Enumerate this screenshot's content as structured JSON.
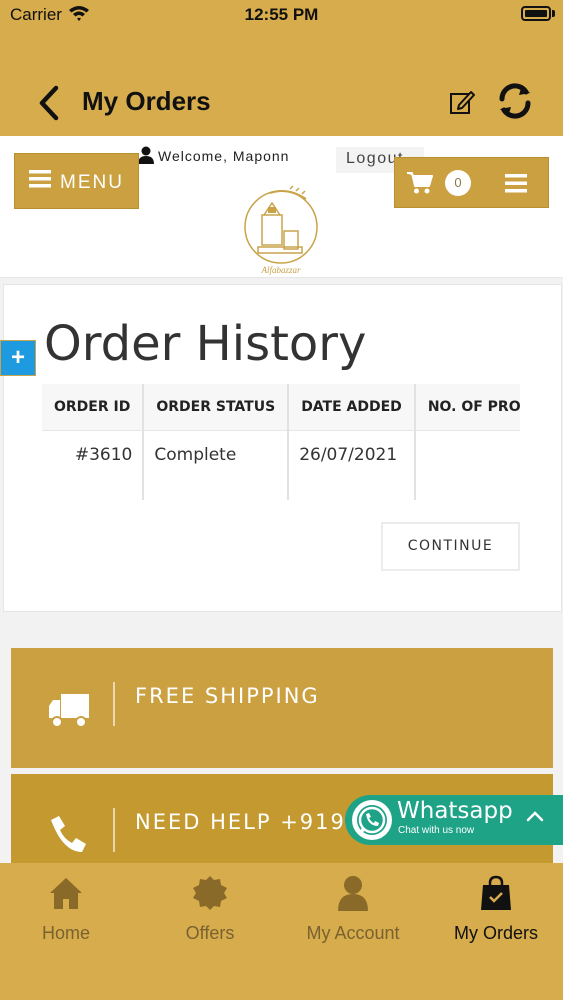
{
  "status_bar": {
    "carrier": "Carrier",
    "time": "12:55 PM"
  },
  "nav": {
    "title": "My Orders",
    "back_icon": "chevron-left-icon",
    "edit_icon": "edit-icon",
    "refresh_icon": "refresh-icon"
  },
  "header": {
    "welcome": "Welcome, Maponn",
    "logout": "Logout",
    "menu_label": "MENU",
    "cart_count": "0",
    "logo_text": "Alfabazzar"
  },
  "main": {
    "title": "Order History",
    "table": {
      "headers": [
        "ORDER ID",
        "ORDER STATUS",
        "DATE ADDED",
        "NO. OF PRODUCTS"
      ],
      "rows": [
        {
          "order_id": "#3610",
          "status": "Complete",
          "date": "26/07/2021",
          "products": ""
        }
      ]
    },
    "continue_label": "CONTINUE"
  },
  "banners": {
    "shipping": "FREE SHIPPING",
    "help": "NEED HELP +91987"
  },
  "whatsapp": {
    "title": "Whatsapp",
    "subtitle": "Chat with us now"
  },
  "tabbar": {
    "tabs": [
      {
        "label": "Home",
        "icon": "home-icon"
      },
      {
        "label": "Offers",
        "icon": "offers-badge-icon"
      },
      {
        "label": "My Account",
        "icon": "user-icon"
      },
      {
        "label": "My Orders",
        "icon": "shopping-bag-icon",
        "active": true
      }
    ]
  },
  "colors": {
    "brand_gold": "#d6ac4c",
    "button_gold": "#caa040",
    "whatsapp_green": "#1ea387",
    "plus_blue": "#1e9be0"
  }
}
